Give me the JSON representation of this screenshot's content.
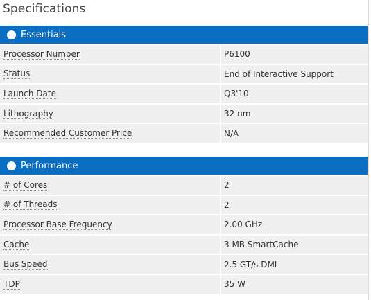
{
  "page": {
    "title": "Specifications"
  },
  "colors": {
    "header_bg": "#0a6fc2",
    "row_bg": "#f0f0f0",
    "text": "#333333"
  },
  "sections": [
    {
      "title": "Essentials",
      "icon": "minus-circle-icon",
      "rows": [
        {
          "label": "Processor Number",
          "value": "P6100"
        },
        {
          "label": "Status",
          "value": "End of Interactive Support"
        },
        {
          "label": "Launch Date",
          "value": "Q3'10"
        },
        {
          "label": "Lithography",
          "value": "32 nm"
        },
        {
          "label": "Recommended Customer Price",
          "value": "N/A"
        }
      ]
    },
    {
      "title": "Performance",
      "icon": "minus-circle-icon",
      "rows": [
        {
          "label": "# of Cores",
          "value": "2"
        },
        {
          "label": "# of Threads",
          "value": "2"
        },
        {
          "label": "Processor Base Frequency",
          "value": "2.00 GHz"
        },
        {
          "label": "Cache",
          "value": "3 MB SmartCache"
        },
        {
          "label": "Bus Speed",
          "value": "2.5 GT/s DMI"
        },
        {
          "label": "TDP",
          "value": "35 W"
        }
      ]
    }
  ]
}
